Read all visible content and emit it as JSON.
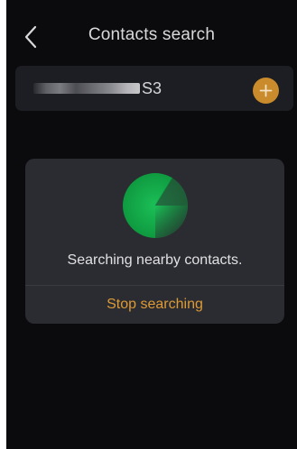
{
  "header": {
    "back_icon": "chevron-left-icon",
    "title": "Contacts search"
  },
  "device": {
    "name_suffix": "S3",
    "add_icon": "plus-icon",
    "accent_color": "#c98b2c"
  },
  "dialog": {
    "status_text": "Searching nearby contacts.",
    "stop_label": "Stop searching",
    "radar_icon": "radar-scan-icon",
    "radar_color": "#17b14d",
    "stop_color": "#dd9a35"
  },
  "colors": {
    "background": "#0b0b0d",
    "panel": "#2b2c31"
  }
}
